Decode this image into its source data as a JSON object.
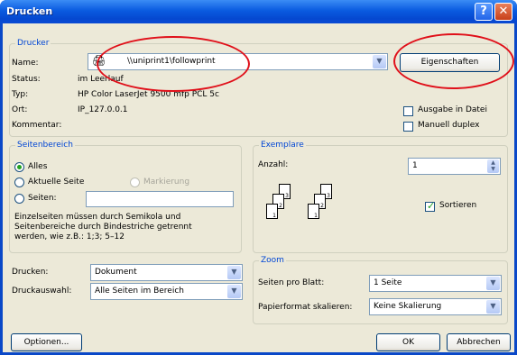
{
  "window": {
    "title": "Drucken",
    "help_glyph": "?",
    "close_glyph": "✕"
  },
  "drucker": {
    "group_label": "Drucker",
    "name_label": "Name:",
    "name_value": "\\\\uniprint1\\followprint",
    "status_label": "Status:",
    "status_value": "im Leerlauf",
    "typ_label": "Typ:",
    "typ_value": "HP Color LaserJet 9500 mfp PCL 5c",
    "ort_label": "Ort:",
    "ort_value": "IP_127.0.0.1",
    "kommentar_label": "Kommentar:",
    "properties_button": "Eigenschaften",
    "print_to_file": "Ausgabe in Datei",
    "manual_duplex": "Manuell duplex"
  },
  "seitenbereich": {
    "group_label": "Seitenbereich",
    "alles": "Alles",
    "aktuelle_seite": "Aktuelle Seite",
    "markierung": "Markierung",
    "seiten": "Seiten:",
    "seiten_value": "",
    "hint": [
      "Einzelseiten müssen durch Semikola und",
      "Seitenbereiche durch Bindestriche getrennt",
      "werden, wie z.B.: 1;3; 5–12"
    ]
  },
  "exemplare": {
    "group_label": "Exemplare",
    "anzahl_label": "Anzahl:",
    "anzahl_value": "1",
    "sortieren": "Sortieren",
    "page_numbers": [
      "1",
      "2",
      "3"
    ]
  },
  "print_options": {
    "drucken_label": "Drucken:",
    "drucken_value": "Dokument",
    "druckauswahl_label": "Druckauswahl:",
    "druckauswahl_value": "Alle Seiten im Bereich"
  },
  "zoom": {
    "group_label": "Zoom",
    "seiten_pro_blatt_label": "Seiten pro Blatt:",
    "seiten_pro_blatt_value": "1 Seite",
    "papierformat_label": "Papierformat skalieren:",
    "papierformat_value": "Keine Skalierung"
  },
  "footer": {
    "optionen": "Optionen...",
    "ok": "OK",
    "abbrechen": "Abbrechen"
  },
  "icons": {
    "select_arrow": "▼",
    "spin_up": "▲",
    "spin_down": "▼"
  }
}
